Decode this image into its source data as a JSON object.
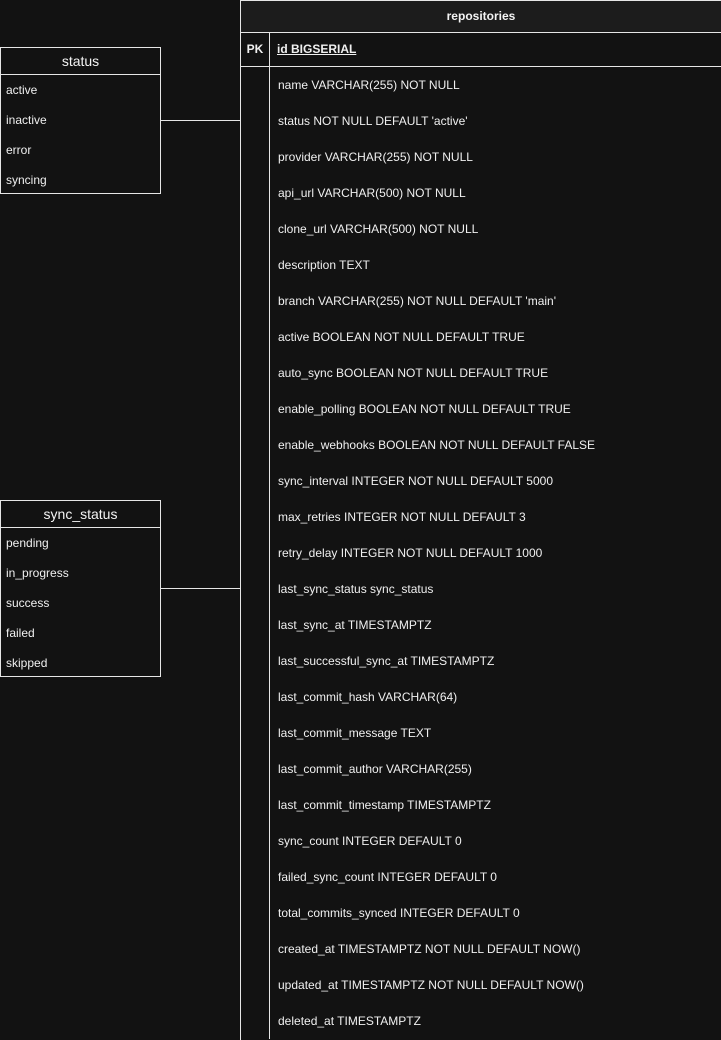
{
  "status_enum": {
    "title": "status",
    "values": [
      "active",
      "inactive",
      "error",
      "syncing"
    ]
  },
  "sync_status_enum": {
    "title": "sync_status",
    "values": [
      "pending",
      "in_progress",
      "success",
      "failed",
      "skipped"
    ]
  },
  "repositories": {
    "title": "repositories",
    "pk_label": "PK",
    "pk_column": "id BIGSERIAL",
    "columns": [
      "name VARCHAR(255) NOT NULL",
      "status NOT NULL DEFAULT 'active'",
      "provider VARCHAR(255) NOT NULL",
      "api_url VARCHAR(500) NOT NULL",
      "clone_url VARCHAR(500) NOT NULL",
      "description TEXT",
      "branch VARCHAR(255) NOT NULL DEFAULT 'main'",
      "active BOOLEAN NOT NULL DEFAULT TRUE",
      "auto_sync BOOLEAN NOT NULL DEFAULT TRUE",
      "enable_polling BOOLEAN NOT NULL DEFAULT TRUE",
      "enable_webhooks BOOLEAN NOT NULL DEFAULT FALSE",
      "sync_interval INTEGER NOT NULL DEFAULT 5000",
      "max_retries INTEGER NOT NULL DEFAULT 3",
      "retry_delay INTEGER NOT NULL DEFAULT 1000",
      "last_sync_status sync_status",
      "last_sync_at TIMESTAMPTZ",
      "last_successful_sync_at TIMESTAMPTZ",
      "last_commit_hash VARCHAR(64)",
      "last_commit_message TEXT",
      "last_commit_author VARCHAR(255)",
      "last_commit_timestamp TIMESTAMPTZ",
      "sync_count INTEGER DEFAULT 0",
      "failed_sync_count INTEGER DEFAULT 0",
      "total_commits_synced INTEGER DEFAULT 0",
      "created_at TIMESTAMPTZ NOT NULL DEFAULT NOW()",
      "updated_at TIMESTAMPTZ NOT NULL DEFAULT NOW()",
      "deleted_at TIMESTAMPTZ"
    ]
  }
}
